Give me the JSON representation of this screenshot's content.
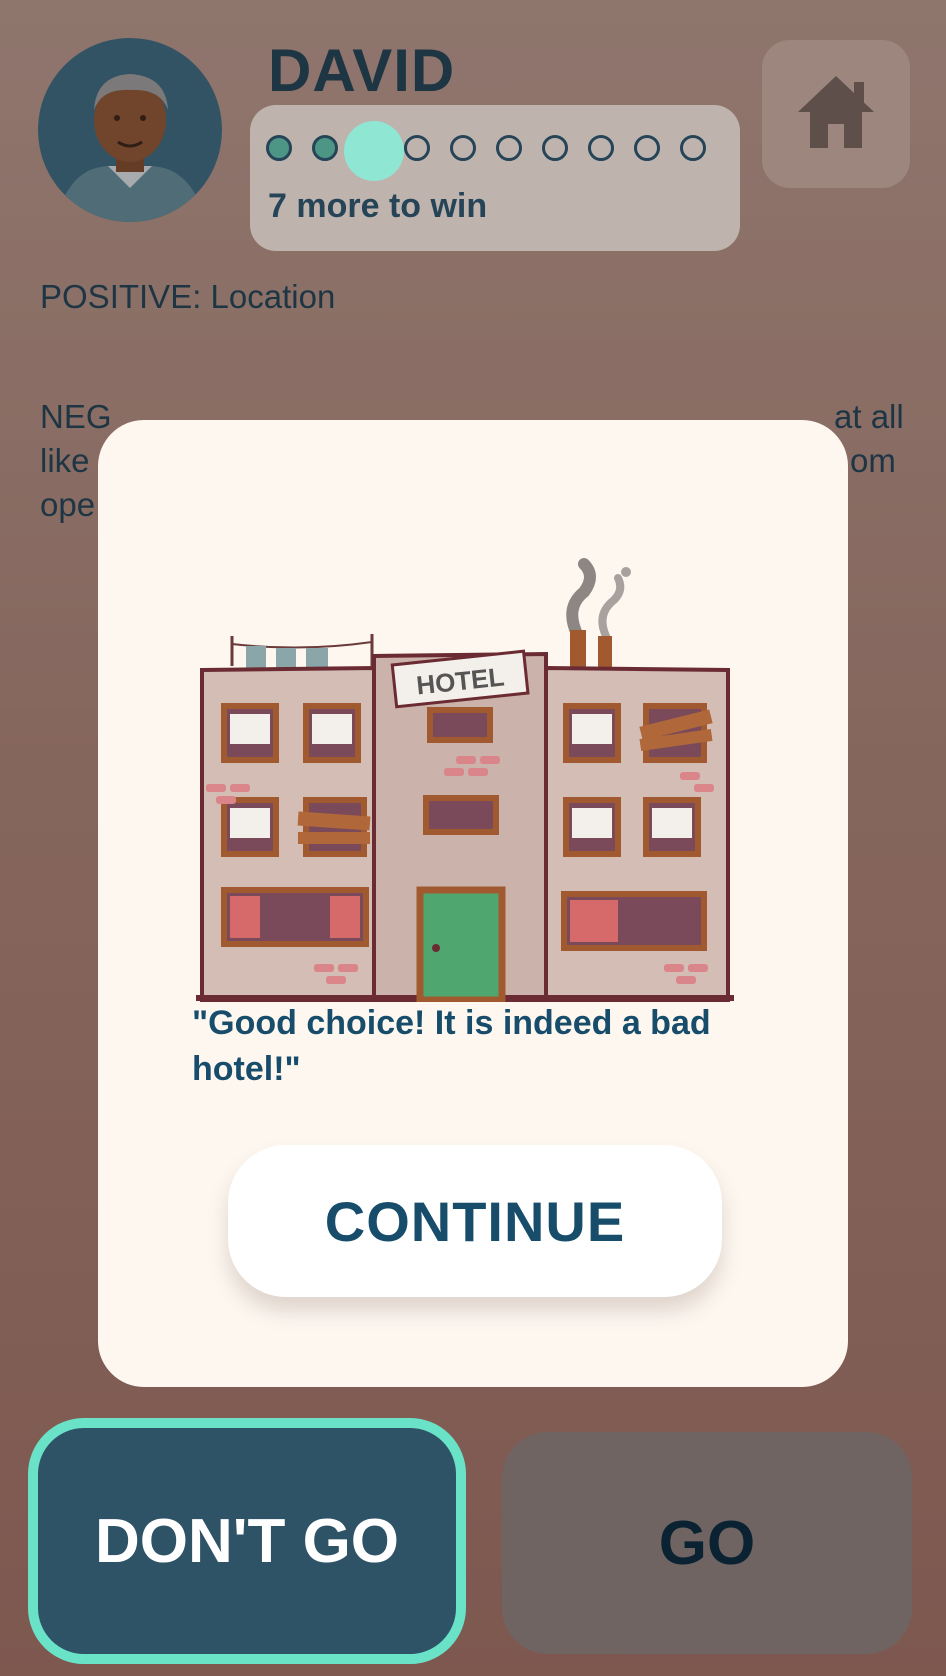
{
  "player": {
    "name": "DAVID",
    "progress_text": "7 more to win",
    "progress_filled": 3,
    "progress_total": 10
  },
  "review": {
    "positive": "POSITIVE: Location",
    "negative_visible": [
      "NEG",
      "at all",
      "like",
      "om",
      "ope"
    ]
  },
  "modal": {
    "sign_text": "HOTEL",
    "feedback": "\"Good choice! It is indeed a bad hotel!\"",
    "continue_label": "CONTINUE"
  },
  "actions": {
    "dont_go_label": "DON'T GO",
    "go_label": "GO"
  },
  "colors": {
    "accent": "#6ae2c8",
    "navy": "#0f3e57",
    "modal_bg": "#fdf7f0"
  },
  "icons": {
    "home": "home-icon"
  }
}
